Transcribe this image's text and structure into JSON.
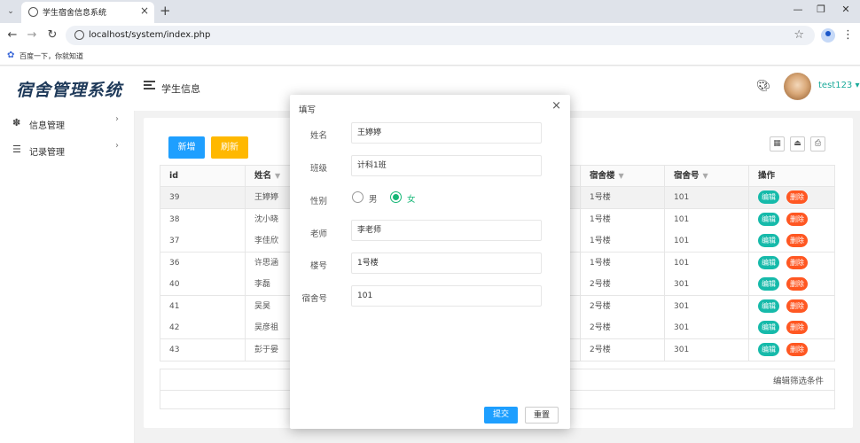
{
  "browser": {
    "tab_title": "学生宿舍信息系统",
    "url": "localhost/system/index.php",
    "bookmark": "百度一下，你就知道"
  },
  "app": {
    "logo": "宿舍管理系统",
    "header_title": "学生信息",
    "username": "test123"
  },
  "sidebar": {
    "items": [
      {
        "label": "信息管理"
      },
      {
        "label": "记录管理"
      }
    ]
  },
  "toolbar": {
    "add_label": "新增",
    "refresh_label": "刷新"
  },
  "table": {
    "headers": [
      "id",
      "姓名",
      "宿舍楼",
      "宿舍号",
      "操作"
    ],
    "edit_label": "编辑",
    "delete_label": "删除",
    "rows": [
      {
        "id": "39",
        "name": "王婷婷",
        "building": "1号楼",
        "room": "101"
      },
      {
        "id": "38",
        "name": "沈小晓",
        "building": "1号楼",
        "room": "101"
      },
      {
        "id": "37",
        "name": "李佳欣",
        "building": "1号楼",
        "room": "101"
      },
      {
        "id": "36",
        "name": "许思涵",
        "building": "1号楼",
        "room": "101"
      },
      {
        "id": "40",
        "name": "李磊",
        "building": "2号楼",
        "room": "301"
      },
      {
        "id": "41",
        "name": "吴昊",
        "building": "2号楼",
        "room": "301"
      },
      {
        "id": "42",
        "name": "吴彦祖",
        "building": "2号楼",
        "room": "301"
      },
      {
        "id": "43",
        "name": "彭于晏",
        "building": "2号楼",
        "room": "301"
      }
    ],
    "footer_label": "编辑筛选条件"
  },
  "modal": {
    "title": "填写",
    "fields": {
      "name": {
        "label": "姓名",
        "value": "王婷婷"
      },
      "class": {
        "label": "班级",
        "value": "计科1班"
      },
      "gender": {
        "label": "性别",
        "options": [
          "男",
          "女"
        ],
        "selected": "女"
      },
      "teacher": {
        "label": "老师",
        "value": "李老师"
      },
      "building": {
        "label": "楼号",
        "value": "1号楼"
      },
      "room": {
        "label": "宿舍号",
        "value": "101"
      }
    },
    "submit_label": "提交",
    "reset_label": "重置"
  },
  "colors": {
    "primary": "#1e9fff",
    "warning": "#ffb800",
    "success": "#16baaa",
    "danger": "#ff5722",
    "radio_checked": "#16b777"
  }
}
